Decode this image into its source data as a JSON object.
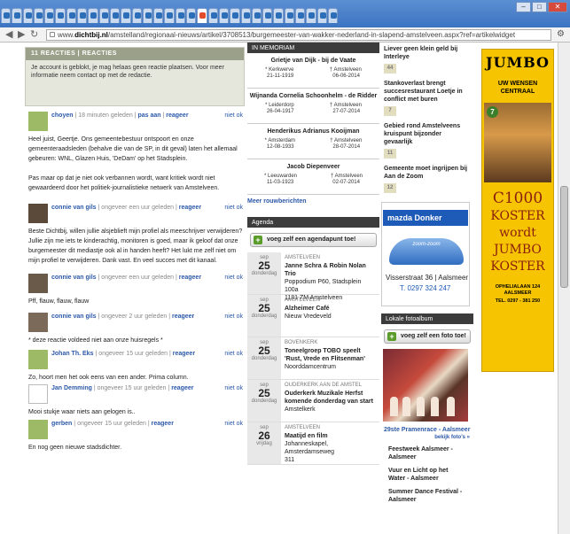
{
  "browser": {
    "url_prefix": "www.",
    "url_domain": "dichtbij.nl",
    "url_path": "/amstelland/regionaal-nieuws/artikel/3708513/burgemeester-van-wakker-nederland-in-slapend-amstelveen.aspx?ref=artikelwidget",
    "back_icon": "back-arrow-icon",
    "forward_icon": "forward-arrow-icon",
    "reload_icon": "reload-icon",
    "minimize_label": "–",
    "maximize_label": "□",
    "close_label": "✕",
    "tab_count": 31
  },
  "reactions": {
    "header": "11 REACTIES | REACTIES",
    "notice": "Je account is geblokt, je mag helaas geen reactie plaatsen. Voor meer informatie neem contact op met de redactie.",
    "not_ok": "niet ok",
    "reply": "reageer",
    "comments": [
      {
        "name": "choyen",
        "time": "18 minuten geleden",
        "extra": "pas aan",
        "text": "Heel juist, Geertje. Ons gemeentebestuur ontspoort en onze gemeenteraadsleden (behalve die van de SP, in dit geval) laten het allemaal gebeuren: WNL, Glazen Huis, 'DeDam' op het Stadsplein.\n\nPas maar op dat je niet ook verbannen wordt, want kritiek wordt niet gewaardeerd door het politiek-journalistieke netwerk van Amstelveen."
      },
      {
        "name": "connie van gils",
        "time": "ongeveer een uur geleden",
        "extra": "",
        "text": "Beste Dichtbij, willen jullie alsjeblieft mijn profiel als meeschrijver verwijderen? Jullie zijn me iets te kinderachtig, monitoren is goed, maar ik geloof dat onze burgemeester dit mediastje ook al in handen heeft? Het lukt me zelf niet om mijn profiel te verwijderen. Dank vast. En veel succes met dit kanaal."
      },
      {
        "name": "connie van gils",
        "time": "ongeveer een uur geleden",
        "extra": "",
        "text": "Pff, flauw, flauw, flauw"
      },
      {
        "name": "connie van gils",
        "time": "ongeveer 2 uur geleden",
        "extra": "",
        "text": "* deze reactie voldeed niet aan onze huisregels *"
      },
      {
        "name": "Johan Th. Eks",
        "time": "ongeveer 15 uur geleden",
        "extra": "",
        "text": "Zo, hoort men het ook eens van een ander. Prima column."
      },
      {
        "name": "Jan Demming",
        "time": "ongeveer 15 uur geleden",
        "extra": "",
        "text": "Mooi stukje waar niets aan gelogen is.."
      },
      {
        "name": "gerben",
        "time": "ongeveer 15 uur geleden",
        "extra": "",
        "text": "En nog geen nieuwe stadsdichter."
      }
    ]
  },
  "deaths": {
    "header": "IN MEMORIAM",
    "more_link": "Meer rouwberichten",
    "born_icon": "star-icon",
    "died_icon": "cross-icon",
    "items": [
      {
        "name": "Grietje van Dijk - bij de Vaate",
        "place1": "Kerkwerve",
        "date1": "21-11-1919",
        "place2": "Amstelveen",
        "date2": "06-06-2014"
      },
      {
        "name": "Wijnanda Cornelia Schoonhelm - de Ridder",
        "place1": "Leiderdorp",
        "date1": "26-04-1917",
        "place2": "Amstelveen",
        "date2": "27-07-2014"
      },
      {
        "name": "Henderikus Adrianus Kooijman",
        "place1": "Amsterdam",
        "date1": "12-08-1933",
        "place2": "Amstelveen",
        "date2": "28-07-2014"
      },
      {
        "name": "Jacob Diepenveer",
        "place1": "Leeuwarden",
        "date1": "11-03-1923",
        "place2": "Amstelveen",
        "date2": "02-07-2014"
      }
    ]
  },
  "agenda": {
    "header": "Agenda",
    "add_button": "voeg zelf een agendapunt toe!",
    "events": [
      {
        "month": "sep",
        "day": "25",
        "weekday": "donderdag",
        "city": "AMSTELVEEN",
        "title": "Janne Schra & Robin Nolan Trio",
        "loc1": "Poppodium P60, Stadsplein 100a",
        "loc2": "1181 ZM Amstelveen"
      },
      {
        "month": "sep",
        "day": "25",
        "weekday": "donderdag",
        "city": "AMSTELVEEN",
        "title": "Alzheimer Café",
        "loc1": "Nieuw Vredeveld",
        "loc2": ""
      },
      {
        "month": "sep",
        "day": "25",
        "weekday": "donderdag",
        "city": "BOVENKERK",
        "title": "Toneelgroep TOBO speelt 'Rust, Vrede en Flitsenman'",
        "loc1": "Noorddamcentrum",
        "loc2": ""
      },
      {
        "month": "sep",
        "day": "25",
        "weekday": "donderdag",
        "city": "OUDERKERK AAN DE AMSTEL",
        "title": "Ouderkerk Muzikale Herfst komende donderdag van start",
        "loc1": "Amstelkerk",
        "loc2": ""
      },
      {
        "month": "sep",
        "day": "26",
        "weekday": "vrijdag",
        "city": "AMSTELVEEN",
        "title": "Maatijd en film",
        "loc1": "Johanneskapel, Amsterdamseweg",
        "loc2": "311"
      }
    ]
  },
  "news": {
    "items": [
      {
        "title": "Liever geen klein geld bij Interleye",
        "count": "44"
      },
      {
        "title": "Stankoverlast brengt succesrestaurant Loetje in conflict met buren",
        "count": "7"
      },
      {
        "title": "Gebied rond Amstelveens kruispunt bijzonder gevaarlijk",
        "count": "11"
      },
      {
        "title": "Gemeente moet ingrijpen bij Aan de Zoom",
        "count": "12"
      }
    ]
  },
  "mazda_ad": {
    "brand": "mazda",
    "dealer": "Donker",
    "slogan": "zoom-zoom",
    "address": "Visserstraat 36 | Aalsmeer",
    "phone": "T. 0297 324 247"
  },
  "photos": {
    "header": "Lokale fotoalbum",
    "add_button": "voeg zelf een foto toe!",
    "caption": "29ste Pramenrace - Aalsmeer",
    "view_link": "bekijk foto's »",
    "list": [
      "Feestweek Aalsmeer - Aalsmeer",
      "Vuur en Licht op het Water - Aalsmeer",
      "Summer Dance Festival - Aalsmeer"
    ]
  },
  "jumbo_ad": {
    "logo": "JUMBO",
    "line1": "UW WENSEN",
    "line2": "CENTRAAL",
    "badge": "7",
    "amount": "C1000",
    "w1": "KOSTER",
    "w2": "wordt",
    "w3": "JUMBO",
    "w4": "KOSTER",
    "address": "OPHELIALAAN 124 AALSMEER",
    "phone": "TEL. 0297 - 381 250"
  },
  "colors": {
    "accent": "#2b58a8",
    "jumbo_yellow": "#f6c400",
    "green_button": "#5a9c2a"
  }
}
